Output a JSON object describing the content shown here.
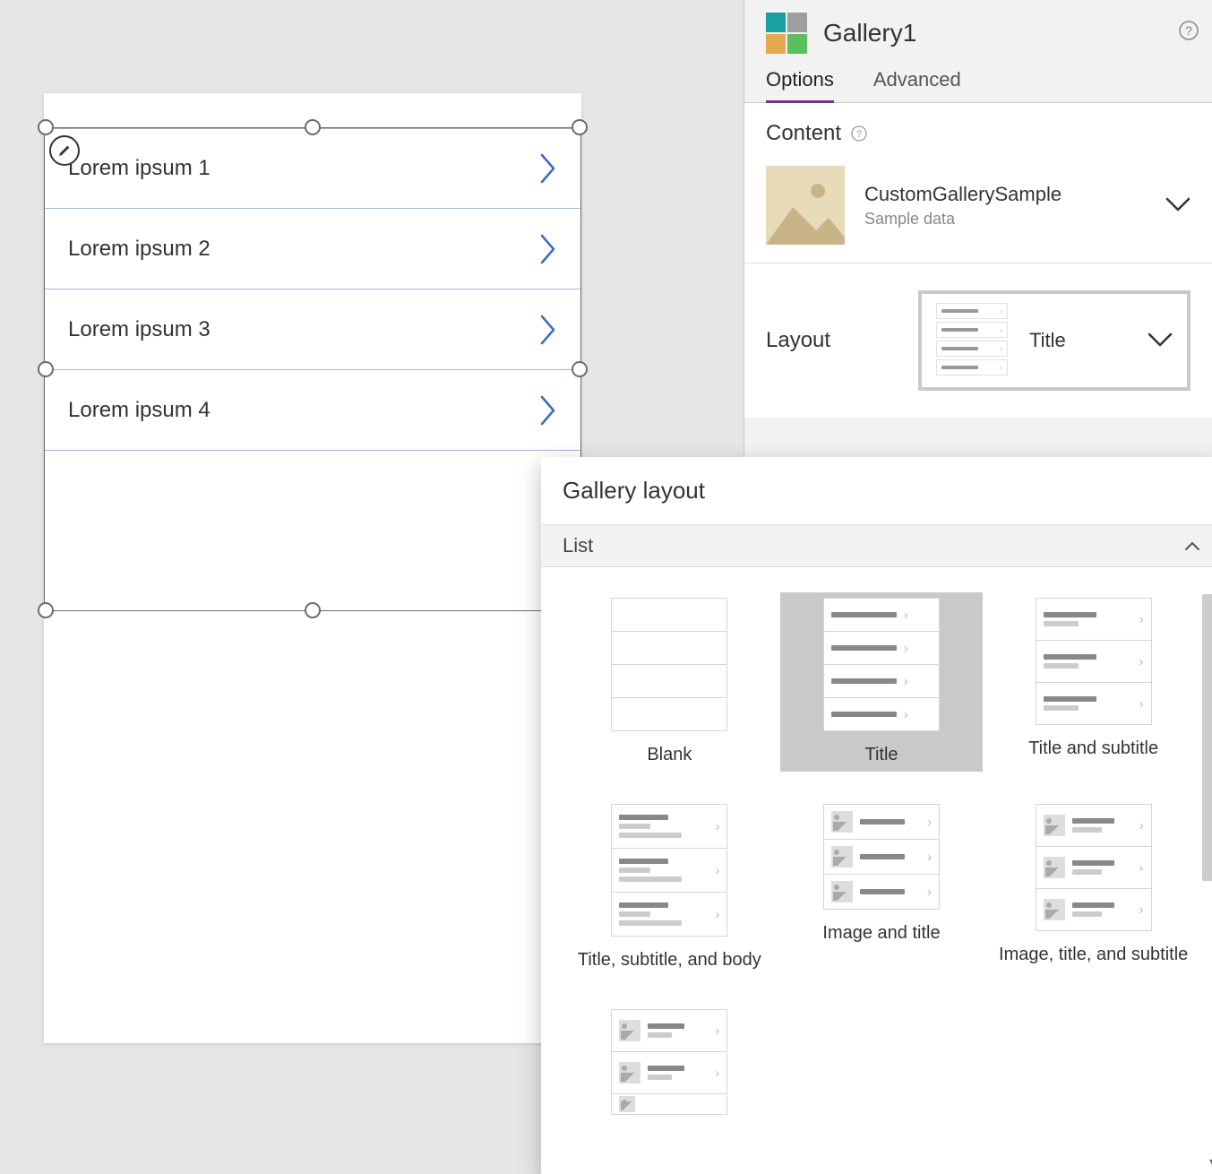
{
  "panel": {
    "title": "Gallery1",
    "tabs": {
      "options": "Options",
      "advanced": "Advanced"
    },
    "icon_colors": [
      "#1aa0a0",
      "#9e9e9e",
      "#e5a84e",
      "#5bbf5b"
    ]
  },
  "content": {
    "heading": "Content",
    "dataSourceName": "CustomGallerySample",
    "dataSourceSub": "Sample data"
  },
  "layout": {
    "label": "Layout",
    "selected": "Title"
  },
  "gallery": {
    "items": [
      {
        "title": "Lorem ipsum 1"
      },
      {
        "title": "Lorem ipsum 2"
      },
      {
        "title": "Lorem ipsum 3"
      },
      {
        "title": "Lorem ipsum 4"
      }
    ]
  },
  "flyout": {
    "title": "Gallery layout",
    "group": "List",
    "options": [
      {
        "label": "Blank"
      },
      {
        "label": "Title"
      },
      {
        "label": "Title and subtitle"
      },
      {
        "label": "Title, subtitle, and body"
      },
      {
        "label": "Image and title"
      },
      {
        "label": "Image, title, and subtitle"
      }
    ]
  }
}
